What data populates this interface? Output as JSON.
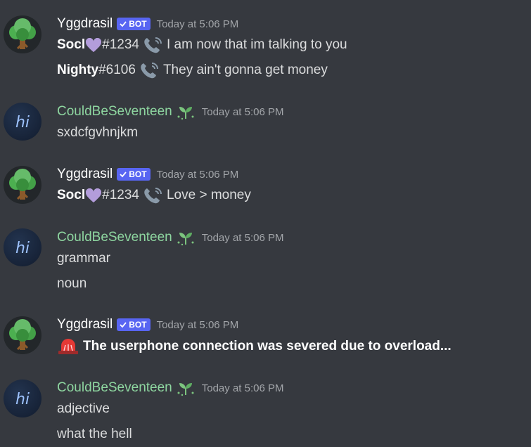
{
  "messages": [
    {
      "author": "Yggdrasil",
      "bot_label": "BOT",
      "timestamp": "Today at 5:06 PM",
      "lines": [
        {
          "name": "Socl",
          "tag": "#1234",
          "text": "I am now that im talking to you"
        },
        {
          "name": "Nighty",
          "tag": "#6106",
          "text": "They ain't gonna get money"
        }
      ]
    },
    {
      "author": "CouldBeSeventeen",
      "timestamp": "Today at 5:06 PM",
      "lines": [
        {
          "text": "sxdcfgvhnjkm"
        }
      ]
    },
    {
      "author": "Yggdrasil",
      "bot_label": "BOT",
      "timestamp": "Today at 5:06 PM",
      "lines": [
        {
          "name": "Socl",
          "tag": "#1234",
          "text": "Love > money"
        }
      ]
    },
    {
      "author": "CouldBeSeventeen",
      "timestamp": "Today at 5:06 PM",
      "lines": [
        {
          "text": "grammar"
        },
        {
          "text": "noun"
        }
      ]
    },
    {
      "author": "Yggdrasil",
      "bot_label": "BOT",
      "timestamp": "Today at 5:06 PM",
      "lines": [
        {
          "text": "The userphone connection was severed due to overload..."
        }
      ]
    },
    {
      "author": "CouldBeSeventeen",
      "timestamp": "Today at 5:06 PM",
      "lines": [
        {
          "text": "adjective"
        },
        {
          "text": "what the hell"
        }
      ]
    }
  ],
  "avatar_text": "hi",
  "icons": {
    "avatar_bot": "tree-icon",
    "avatar_user": "hi-avatar",
    "badge": "checkmark-icon",
    "sprout": "sprout-icon",
    "heart": "purple-heart-icon",
    "phone": "telephone-receiver-icon",
    "alarm": "rotating-light-icon"
  },
  "colors": {
    "background": "#36393f",
    "username_bot": "#ffffff",
    "username_user": "#8ed6a0",
    "badge": "#5865f2",
    "timestamp": "#a3a6aa",
    "text": "#dcddde"
  }
}
